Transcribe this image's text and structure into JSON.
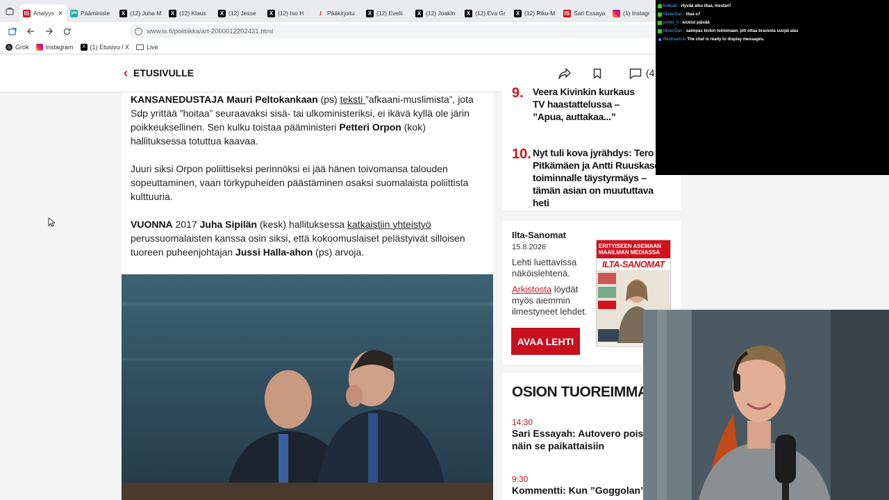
{
  "browser": {
    "tabs": [
      {
        "favicon": "is",
        "label": "Analyys",
        "active": true
      },
      {
        "favicon": "yle",
        "label": "Pääministe"
      },
      {
        "favicon": "x",
        "label": "(12) Juha M"
      },
      {
        "favicon": "x",
        "label": "(12) Klaus"
      },
      {
        "favicon": "x",
        "label": "(12) Jesse"
      },
      {
        "favicon": "x",
        "label": "(12) Iso H"
      },
      {
        "favicon": "it",
        "label": "Pääkirjoitu"
      },
      {
        "favicon": "x",
        "label": "(12) Evelii"
      },
      {
        "favicon": "x",
        "label": "(12) Joakin"
      },
      {
        "favicon": "x",
        "label": "(12) Eva Gr"
      },
      {
        "favicon": "x",
        "label": "(12) Riku-M"
      },
      {
        "favicon": "is",
        "label": "Sari Essaya"
      },
      {
        "favicon": "ig",
        "label": "(1) Instagr"
      }
    ],
    "url": "www.is.fi/politiikka/art-2000012202431.html",
    "bookmarks": [
      {
        "icon": "grok",
        "label": "Grok"
      },
      {
        "icon": "ig",
        "label": "Instagram"
      },
      {
        "icon": "x",
        "label": "(1) Etusivu / X"
      },
      {
        "icon": "folder",
        "label": "Live"
      }
    ]
  },
  "header": {
    "back_label": "ETUSIVULLE",
    "comments_count": "(4"
  },
  "article": {
    "p1": {
      "lead": "KANSANEDUSTAJA",
      "name1": "Mauri Peltokankaan",
      "t1": " (ps) ",
      "link": "teksti ",
      "t2": "”afkaani-muslimista”, jota Sdp yrittää ”hoitaa” seuraavaksi sisä- tai ulkoministeriksi, ei ikävä kyllä ole järin poikkeuksellinen. Sen kulku toistaa pääministeri ",
      "name2": "Petteri Orpon",
      "t3": " (kok) hallituksessa totuttua kaavaa."
    },
    "p2": "Juuri siksi Orpon poliittiseksi perinnöksi ei jää hänen toivomansa talouden sopeuttaminen, vaan törkypuheiden päästäminen osaksi suomalaista poliittista kulttuuria.",
    "p3": {
      "lead": "VUONNA",
      "t1": " 2017 ",
      "name1": "Juha Sipilän",
      "t2": " (kesk) hallituksessa ",
      "link": "katkaistiin yhteistyö",
      "t3": " perussuomalaisten kanssa osin siksi, että kokoomuslaiset pelästyivät silloisen tuoreen puheenjohtajan ",
      "name2": "Jussi Halla-ahon",
      "t4": " (ps) arvoja."
    }
  },
  "most_read": [
    {
      "num": "9.",
      "text": "Veera Kivinkin kurkaus TV haastattelussa – ”Apua, auttakaa...”"
    },
    {
      "num": "10.",
      "text": "Nyt tuli kova jyrähdys: Tero Pitkämäen ja Antti Ruuskasen toiminnalle täystyrmäys – tämän asian on muututtava heti"
    }
  ],
  "paper": {
    "title": "Ilta-Sanomat",
    "date": "15.8.2026",
    "desc": "Lehti luettavissa näköislehtenä.",
    "archive_link": "Arkistosta",
    "archive_rest": " löydät myös aiemmin ilmestyneet lehdet.",
    "button": "AVAA LEHTI",
    "cover_headline": "ERITYISEEN ASEMAAN MAAILMAN MEDIASSA",
    "cover_masthead": "ILTA-SANOMAT"
  },
  "latest": {
    "title": "OSION TUOREIMMAT",
    "items": [
      {
        "time": "14:30",
        "text": "Sari Essayah: Autovero poistettava näin se paikattaisiin"
      },
      {
        "time": "9:30",
        "text": "Kommentti: Kun ”Goggolan” pers"
      }
    ]
  },
  "chat": [
    {
      "user": "kutkiaw",
      "msg": "Hyvää alku iltaa, mestari!"
    },
    {
      "user": "MisterDax",
      "msg": "iltaa o7"
    },
    {
      "user": "porter_fi",
      "msg": "kickist päivää"
    },
    {
      "user": "MisterDax",
      "msg": "saimpas kickin toimimaan. piti ottaa bravesta suojat alas"
    },
    {
      "user": "Restream.io",
      "msg": "The chat is ready to display messages.",
      "system": true
    }
  ],
  "colors": {
    "brand_red": "#d3121d",
    "button_red": "#c8101e"
  }
}
